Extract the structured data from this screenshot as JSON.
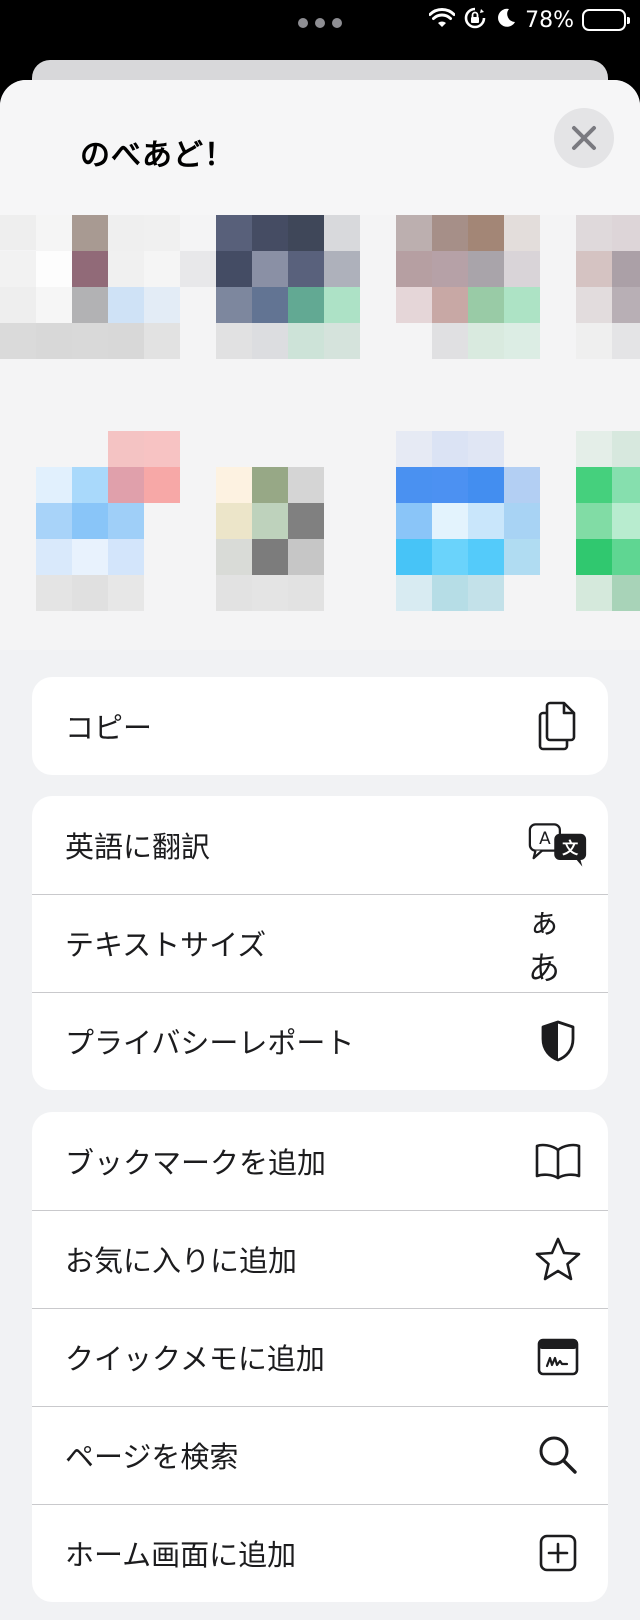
{
  "status": {
    "battery": "78%"
  },
  "sheet": {
    "title": "のべあど！"
  },
  "groups": [
    [
      {
        "label": "コピー",
        "icon": "copy-icon"
      }
    ],
    [
      {
        "label": "英語に翻訳",
        "icon": "translate-icon"
      },
      {
        "label": "テキストサイズ",
        "icon": "text-size-icon",
        "icon_text": "ぁあ"
      },
      {
        "label": "プライバシーレポート",
        "icon": "privacy-shield-icon"
      }
    ],
    [
      {
        "label": "ブックマークを追加",
        "icon": "book-icon"
      },
      {
        "label": "お気に入りに追加",
        "icon": "star-icon"
      },
      {
        "label": "クイックメモに追加",
        "icon": "quick-note-icon"
      },
      {
        "label": "ページを検索",
        "icon": "search-icon"
      },
      {
        "label": "ホーム画面に追加",
        "icon": "add-square-icon"
      }
    ]
  ]
}
